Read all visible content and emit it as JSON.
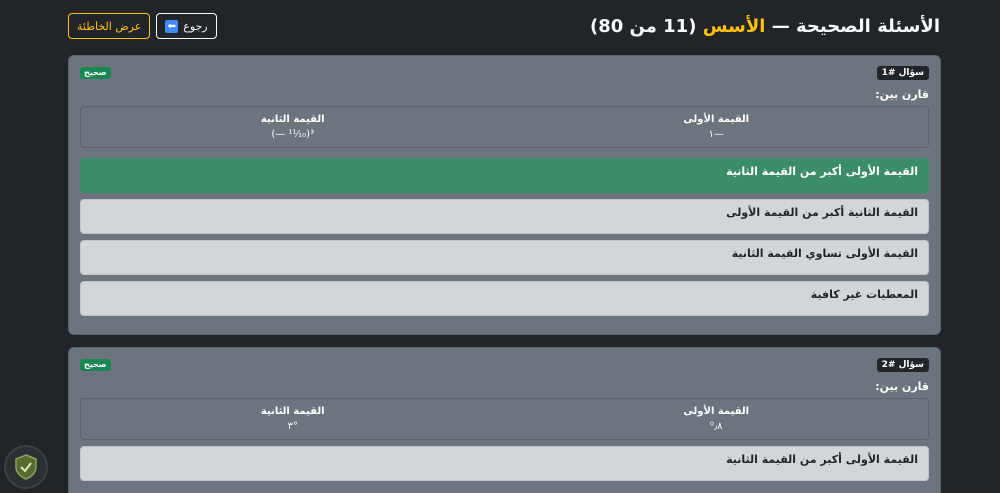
{
  "header": {
    "title_prefix": "الأسئلة الصحيحة — ",
    "title_accent": "الأسس",
    "title_suffix": " (11 من 80)",
    "back_label": "رجوع",
    "show_wrong_label": "عرض الخاطئة"
  },
  "questions": [
    {
      "number_label": "سؤال #1",
      "status": "صحيح",
      "prompt": "قارن بين:",
      "first_label": "القيمة الأولى",
      "first_value": "١—",
      "second_label": "القيمة الثانية",
      "second_value": "(— ¹¹⁄₁₀)³",
      "options": [
        "القيمة الأولى أكبر من القيمة الثانية",
        "القيمة الثانية أكبر من القيمة الأولى",
        "القيمة الأولى تساوي القيمة الثانية",
        "المعطيات غير كافية"
      ]
    },
    {
      "number_label": "سؤال #2",
      "status": "صحيح",
      "prompt": "قارن بين:",
      "first_label": "القيمة الأولى",
      "first_value": "⁰٫٨",
      "second_label": "القيمة الثانية",
      "second_value": "٣°",
      "options": [
        "القيمة الأولى أكبر من القيمة الثانية"
      ]
    }
  ]
}
